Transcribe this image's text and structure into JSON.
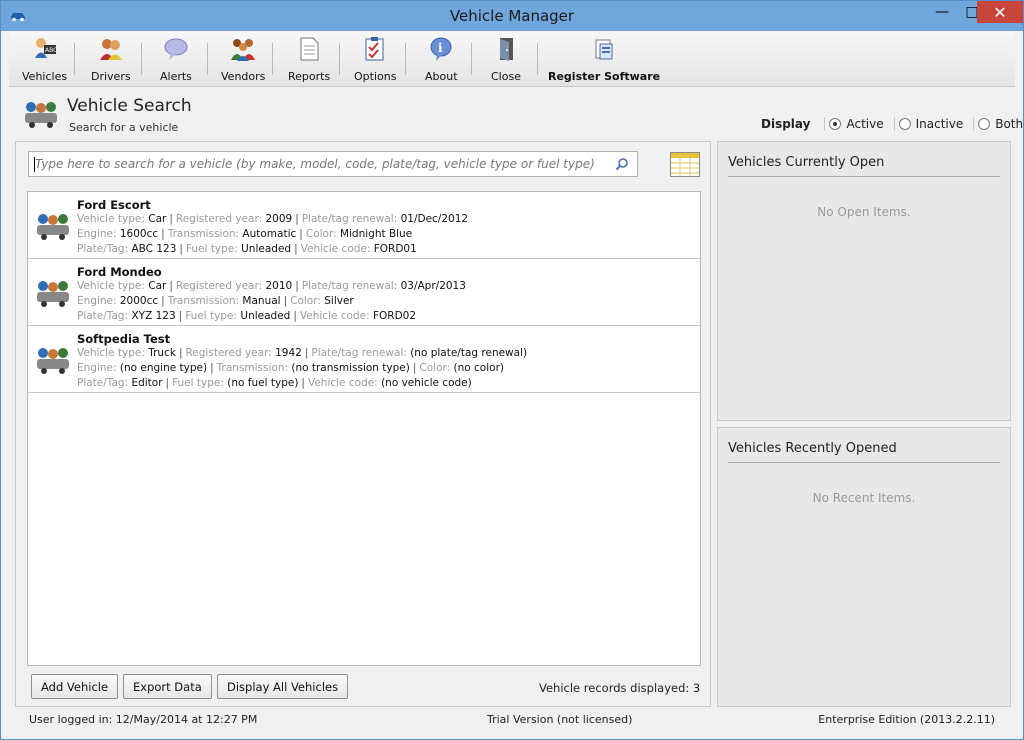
{
  "window": {
    "title": "Vehicle Manager"
  },
  "toolbar": {
    "vehicles": "Vehicles",
    "drivers": "Drivers",
    "alerts": "Alerts",
    "vendors": "Vendors",
    "reports": "Reports",
    "options": "Options",
    "about": "About",
    "close": "Close",
    "register": "Register Software"
  },
  "header": {
    "title": "Vehicle Search",
    "subtitle": "Search for a vehicle",
    "display_label": "Display",
    "options": [
      "Active",
      "Inactive",
      "Both"
    ],
    "selected": "Active"
  },
  "search": {
    "placeholder": "Type here to search for a vehicle (by make, model, code, plate/tag, vehicle type or fuel type)"
  },
  "labels": {
    "vehicle_type": "Vehicle type:",
    "registered_year": "Registered year:",
    "plate_renewal": "Plate/tag renewal:",
    "engine": "Engine:",
    "transmission": "Transmission:",
    "color": "Color:",
    "plate_tag": "Plate/Tag:",
    "fuel_type": "Fuel type:",
    "vehicle_code": "Vehicle code:"
  },
  "vehicles": [
    {
      "name": "Ford Escort",
      "type": "Car",
      "year": "2009",
      "renewal": "01/Dec/2012",
      "engine": "1600cc",
      "transmission": "Automatic",
      "color": "Midnight Blue",
      "plate": "ABC 123",
      "fuel": "Unleaded",
      "code": "FORD01"
    },
    {
      "name": "Ford Mondeo",
      "type": "Car",
      "year": "2010",
      "renewal": "03/Apr/2013",
      "engine": "2000cc",
      "transmission": "Manual",
      "color": "Silver",
      "plate": "XYZ 123",
      "fuel": "Unleaded",
      "code": "FORD02"
    },
    {
      "name": "Softpedia Test",
      "type": "Truck",
      "year": "1942",
      "renewal": "(no plate/tag renewal)",
      "engine": "(no engine type)",
      "transmission": "(no transmission type)",
      "color": "(no color)",
      "plate": "Editor",
      "fuel": "(no fuel type)",
      "code": "(no vehicle code)"
    }
  ],
  "actions": {
    "add": "Add Vehicle",
    "export": "Export Data",
    "display_all": "Display All Vehicles",
    "records": "Vehicle records displayed:  3"
  },
  "side": {
    "open_title": "Vehicles Currently Open",
    "open_empty": "No Open Items.",
    "recent_title": "Vehicles Recently Opened",
    "recent_empty": "No Recent Items."
  },
  "status": {
    "user": "User logged in:  12/May/2014 at 12:27 PM",
    "license": "Trial Version (not licensed)",
    "edition": "Enterprise Edition (2013.2.2.11)"
  },
  "colors": {
    "titlebar": "#6fa6db",
    "close": "#c7453b"
  }
}
